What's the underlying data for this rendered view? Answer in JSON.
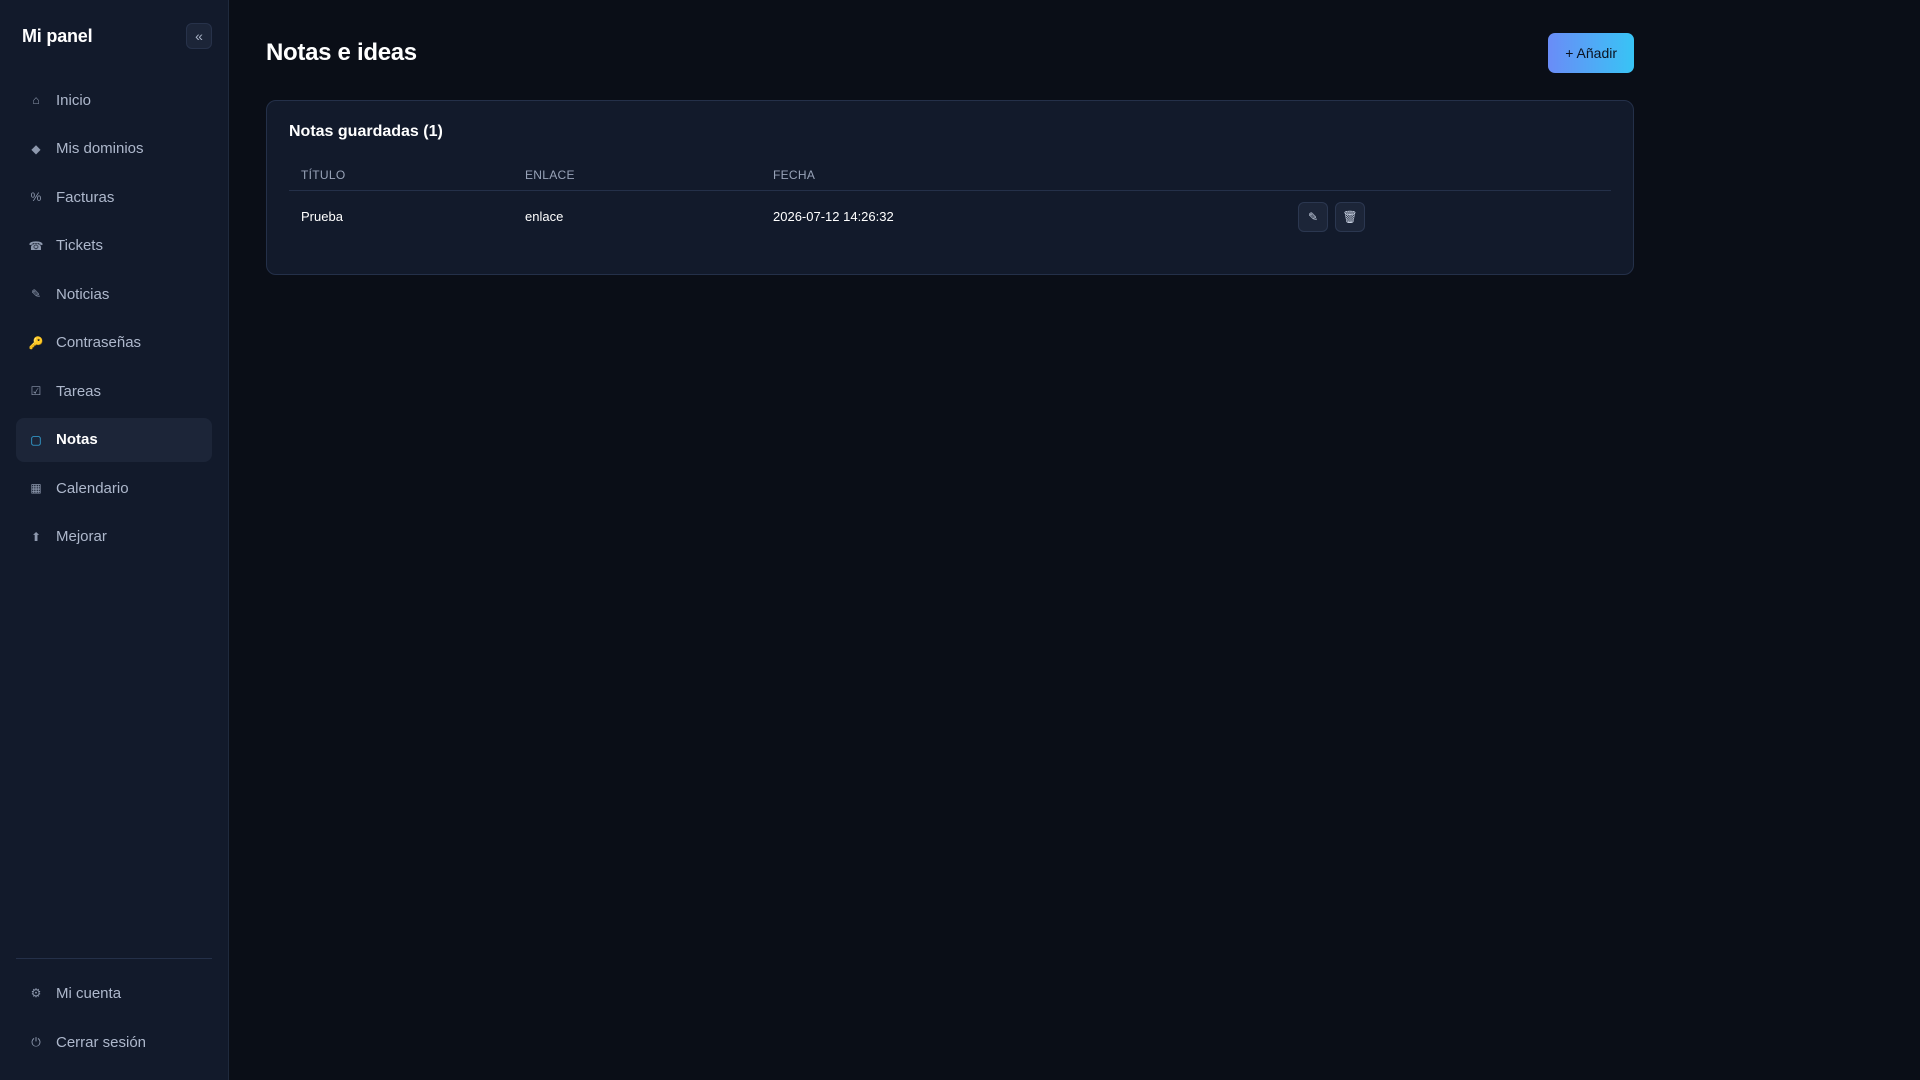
{
  "sidebar": {
    "brand": "Mi panel",
    "collapse_label": "«",
    "items": [
      {
        "label": "Inicio",
        "icon": "⌂"
      },
      {
        "label": "Mis dominios",
        "icon": "◆"
      },
      {
        "label": "Facturas",
        "icon": "%"
      },
      {
        "label": "Tickets",
        "icon": "☎"
      },
      {
        "label": "Noticias",
        "icon": "✎"
      },
      {
        "label": "Contraseñas",
        "icon": "🔑"
      },
      {
        "label": "Tareas",
        "icon": "☑"
      },
      {
        "label": "Notas",
        "icon": "▢"
      },
      {
        "label": "Calendario",
        "icon": "▦"
      },
      {
        "label": "Mejorar",
        "icon": "⬆"
      }
    ],
    "active_item": "Notas",
    "footer_items": [
      {
        "label": "Mi cuenta",
        "icon": "⚙"
      },
      {
        "label": "Cerrar sesión",
        "icon": "⏻"
      }
    ]
  },
  "header": {
    "title": "Notas e ideas",
    "add_button_label": "+ Añadir"
  },
  "notes_card": {
    "title": "Notas guardadas (1)",
    "columns": [
      "TÍTULO",
      "ENLACE",
      "FECHA"
    ],
    "rows": [
      {
        "titulo": "Prueba",
        "enlace": "enlace",
        "fecha": "2026-07-12 14:26:32"
      }
    ],
    "edit_icon": "✎",
    "delete_icon": "🗑"
  },
  "colors": {
    "background": "#0a0e17",
    "sidebar": "#121a2b",
    "accent_start": "#6a8cf7",
    "accent_end": "#38c4f5",
    "active_icon": "#38bdf8"
  }
}
